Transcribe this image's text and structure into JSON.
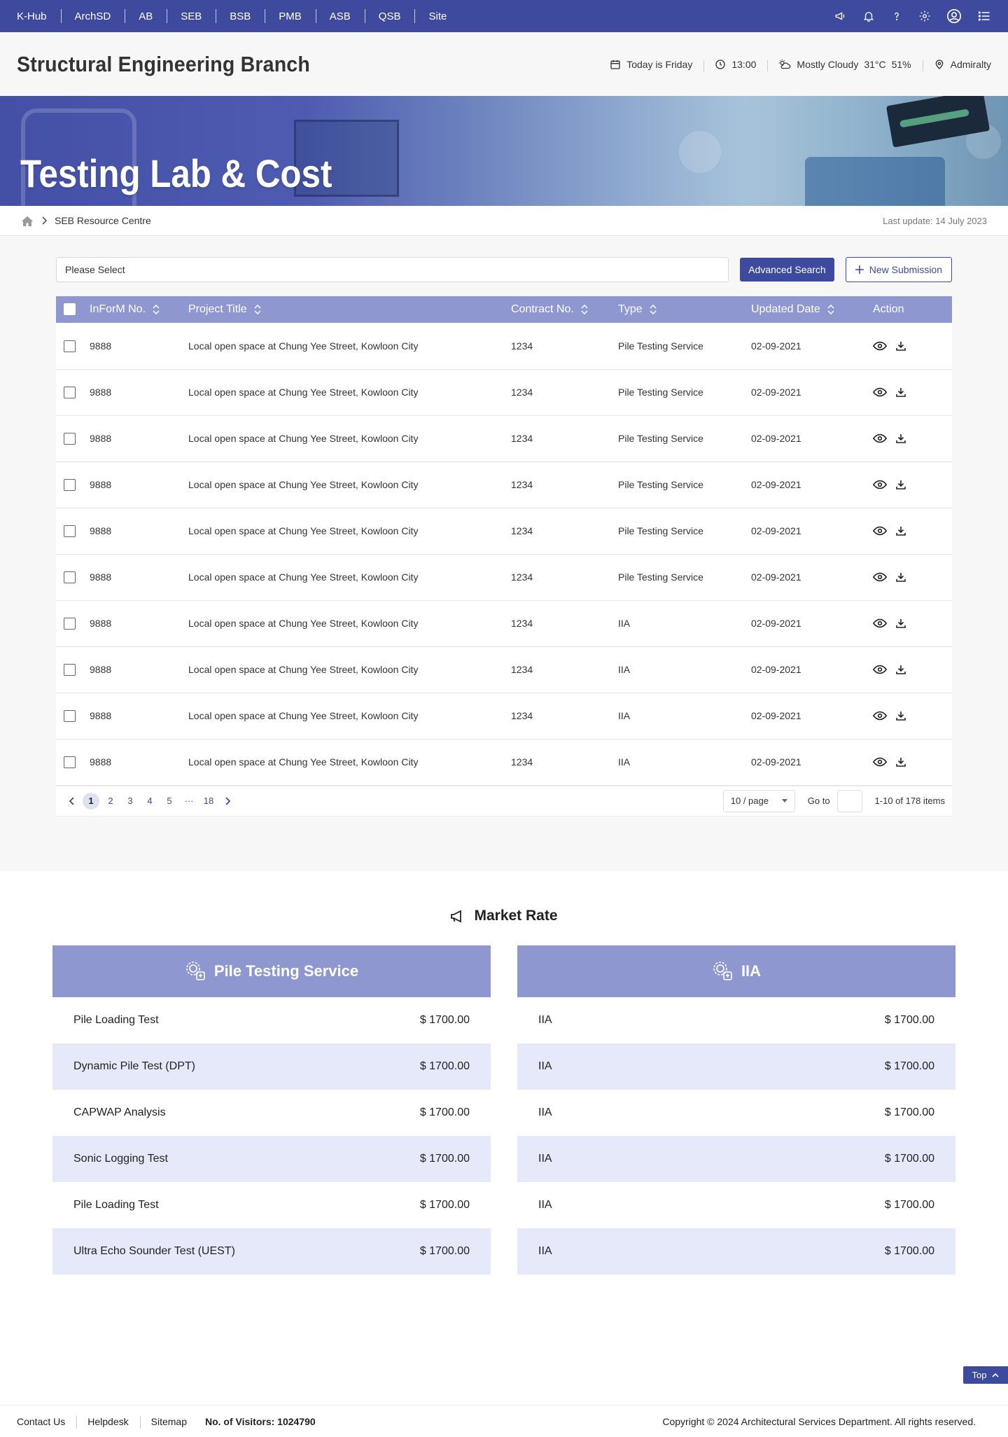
{
  "topnav": {
    "links": [
      "K-Hub",
      "ArchSD",
      "AB",
      "SEB",
      "BSB",
      "PMB",
      "ASB",
      "QSB",
      "Site"
    ],
    "icons": [
      "megaphone-icon",
      "bell-icon",
      "help-icon",
      "gear-icon",
      "user-icon",
      "menu-icon"
    ]
  },
  "header": {
    "title": "Structural Engineering Branch",
    "date_text": "Today is Friday",
    "time": "13:00",
    "weather": "Mostly Cloudy",
    "temperature": "31°C",
    "humidity": "51%",
    "location": "Admiralty"
  },
  "banner": {
    "title": "Testing Lab & Cost"
  },
  "breadcrumb": {
    "current": "SEB Resource Centre",
    "last_update": "Last update: 14 July 2023"
  },
  "search": {
    "select_placeholder": "Please Select",
    "advanced_label": "Advanced Search",
    "new_submission_label": "New Submission"
  },
  "table": {
    "columns": [
      "InForM No.",
      "Project Title",
      "Contract No.",
      "Type",
      "Updated Date",
      "Action"
    ],
    "rows": [
      [
        "9888",
        "Local open space at Chung Yee Street, Kowloon City",
        "1234",
        "Pile Testing Service",
        "02-09-2021"
      ],
      [
        "9888",
        "Local open space at Chung Yee Street, Kowloon City",
        "1234",
        "Pile Testing Service",
        "02-09-2021"
      ],
      [
        "9888",
        "Local open space at Chung Yee Street, Kowloon City",
        "1234",
        "Pile Testing Service",
        "02-09-2021"
      ],
      [
        "9888",
        "Local open space at Chung Yee Street, Kowloon City",
        "1234",
        "Pile Testing Service",
        "02-09-2021"
      ],
      [
        "9888",
        "Local open space at Chung Yee Street, Kowloon City",
        "1234",
        "Pile Testing Service",
        "02-09-2021"
      ],
      [
        "9888",
        "Local open space at Chung Yee Street, Kowloon City",
        "1234",
        "Pile Testing Service",
        "02-09-2021"
      ],
      [
        "9888",
        "Local open space at Chung Yee Street, Kowloon City",
        "1234",
        "IIA",
        "02-09-2021"
      ],
      [
        "9888",
        "Local open space at Chung Yee Street, Kowloon City",
        "1234",
        "IIA",
        "02-09-2021"
      ],
      [
        "9888",
        "Local open space at Chung Yee Street, Kowloon City",
        "1234",
        "IIA",
        "02-09-2021"
      ],
      [
        "9888",
        "Local open space at Chung Yee Street, Kowloon City",
        "1234",
        "IIA",
        "02-09-2021"
      ]
    ]
  },
  "pagination": {
    "pages": [
      "1",
      "2",
      "3",
      "4",
      "5",
      "···",
      "18"
    ],
    "active": "1",
    "page_size": "10 / page",
    "goto_label": "Go to",
    "summary": "1-10 of 178 items"
  },
  "market": {
    "title": "Market Rate",
    "columns": [
      {
        "name": "Pile Testing Service",
        "items": [
          [
            "Pile Loading Test",
            "$ 1700.00"
          ],
          [
            "Dynamic Pile Test (DPT)",
            "$ 1700.00"
          ],
          [
            "CAPWAP Analysis",
            "$ 1700.00"
          ],
          [
            "Sonic Logging Test",
            "$ 1700.00"
          ],
          [
            "Pile Loading Test",
            "$ 1700.00"
          ],
          [
            "Ultra Echo Sounder Test (UEST)",
            "$ 1700.00"
          ]
        ]
      },
      {
        "name": "IIA",
        "items": [
          [
            "IIA",
            "$ 1700.00"
          ],
          [
            "IIA",
            "$ 1700.00"
          ],
          [
            "IIA",
            "$ 1700.00"
          ],
          [
            "IIA",
            "$ 1700.00"
          ],
          [
            "IIA",
            "$ 1700.00"
          ],
          [
            "IIA",
            "$ 1700.00"
          ]
        ]
      }
    ]
  },
  "top_button": "Top",
  "footer": {
    "links": [
      "Contact Us",
      "Helpdesk",
      "Sitemap"
    ],
    "visitors": "No. of Visitors: 1024790",
    "copyright": "Copyright © 2024 Architectural Services Department. All rights reserved."
  },
  "colors": {
    "primary": "#3e4a9e",
    "table_header": "#8e97cf",
    "row_stripe": "#e6e9fa"
  }
}
